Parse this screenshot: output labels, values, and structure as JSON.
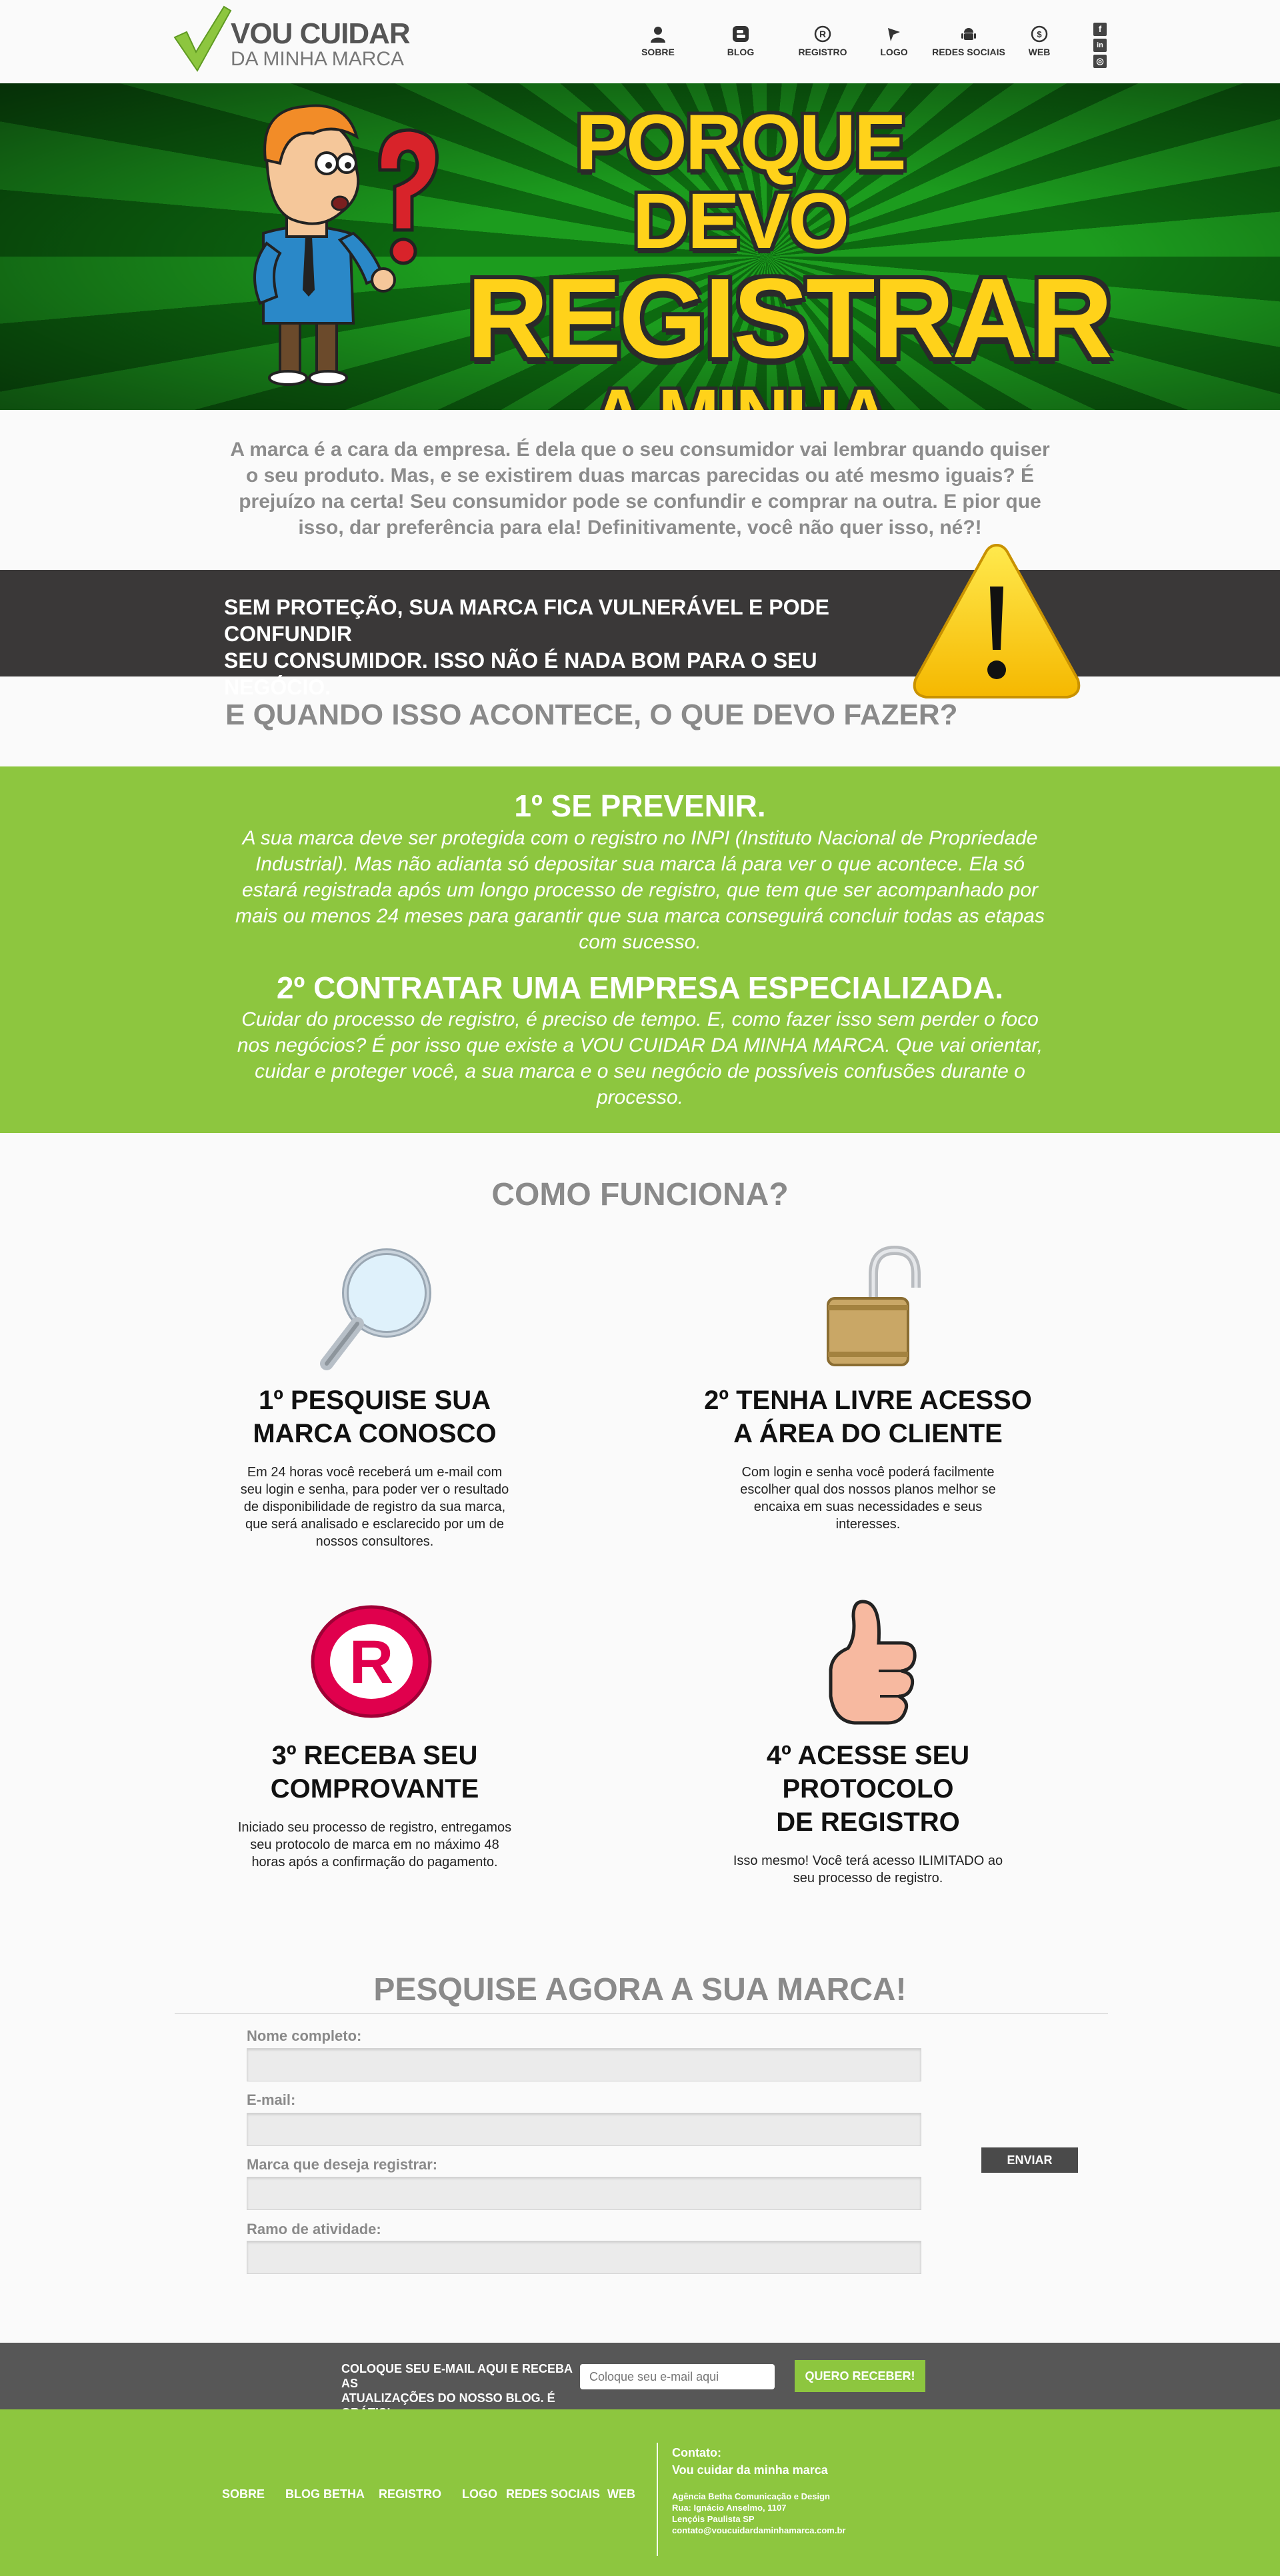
{
  "brand": {
    "line1": "VOU CUIDAR",
    "line2": "DA MINHA MARCA"
  },
  "nav": [
    {
      "label": "SOBRE",
      "icon": "user-icon"
    },
    {
      "label": "BLOG",
      "icon": "blogger-icon"
    },
    {
      "label": "REGISTRO",
      "icon": "registered-icon"
    },
    {
      "label": "LOGO",
      "icon": "pen-nib-icon"
    },
    {
      "label": "REDES SOCIAIS",
      "icon": "android-icon"
    },
    {
      "label": "WEB",
      "icon": "globe-icon"
    }
  ],
  "social": [
    {
      "icon": "facebook-icon",
      "glyph": "f"
    },
    {
      "icon": "linkedin-icon",
      "glyph": "in"
    },
    {
      "icon": "instagram-icon",
      "glyph": "◎"
    }
  ],
  "hero": {
    "line1": "PORQUE DEVO",
    "line2": "REGISTRAR",
    "line3": "A MINHA MARCA?"
  },
  "intro": "A marca é a cara da empresa. É dela que o seu consumidor vai lembrar quando quiser o seu produto. Mas, e se existirem duas marcas parecidas ou até mesmo iguais? É prejuízo na certa! Seu consumidor pode se confundir e comprar na outra. E pior que isso, dar preferência para ela! Definitivamente, você não quer isso, né?!",
  "warning": {
    "line1": "SEM PROTEÇÃO, SUA MARCA FICA VULNERÁVEL E PODE CONFUNDIR",
    "line2": "SEU CONSUMIDOR. ISSO NÃO É NADA BOM PARA O SEU NEGÓCIO."
  },
  "question": "E QUANDO ISSO ACONTECE, O QUE DEVO FAZER?",
  "steps": [
    {
      "title": "1º SE PREVENIR.",
      "text": "A sua marca deve ser protegida com o registro no INPI (Instituto Nacional de Propriedade Industrial). Mas não adianta só depositar sua marca lá para ver o que acontece. Ela só estará registrada após um longo processo de registro, que tem que ser acompanhado por mais ou menos 24 meses para garantir que sua marca conseguirá concluir todas as etapas com sucesso."
    },
    {
      "title": "2º CONTRATAR UMA EMPRESA ESPECIALIZADA.",
      "text": "Cuidar do processo de registro, é preciso de tempo. E, como fazer isso sem perder o foco nos negócios? É por isso que existe a VOU CUIDAR DA MINHA MARCA. Que vai orientar, cuidar e proteger você, a sua marca e o seu negócio de possíveis confusões durante o processo."
    }
  ],
  "how": {
    "title": "COMO FUNCIONA?",
    "items": [
      {
        "icon": "magnifier-icon",
        "title1": "1º PESQUISE SUA",
        "title2": "MARCA CONOSCO",
        "text": "Em 24 horas você receberá um e-mail com seu login e senha, para poder ver o resultado de disponibilidade de registro da sua marca, que será analisado e esclarecido por um de nossos consultores."
      },
      {
        "icon": "open-padlock-icon",
        "title1": "2º TENHA LIVRE ACESSO",
        "title2": "A ÁREA DO CLIENTE",
        "text": "Com login e senha você poderá facilmente escolher qual dos nossos planos melhor se encaixa em suas necessidades e seus interesses."
      },
      {
        "icon": "registered-mark-icon",
        "title1": "3º RECEBA SEU",
        "title2": "COMPROVANTE",
        "text": "Iniciado seu processo de registro, entregamos seu protocolo de marca em no máximo 48 horas após a confirmação do pagamento."
      },
      {
        "icon": "thumbs-up-icon",
        "title1": "4º ACESSE SEU PROTOCOLO",
        "title2": "DE REGISTRO",
        "text": "Isso mesmo! Você terá acesso ILIMITADO ao seu processo de registro."
      }
    ]
  },
  "form": {
    "title": "PESQUISE AGORA A SUA MARCA!",
    "fields": [
      {
        "label": "Nome completo:",
        "value": ""
      },
      {
        "label": "E-mail:",
        "value": ""
      },
      {
        "label": "Marca que deseja registrar:",
        "value": ""
      },
      {
        "label": "Ramo de atividade:",
        "value": ""
      }
    ],
    "submit": "ENVIAR"
  },
  "newsletter": {
    "line1": "COLOQUE SEU E-MAIL AQUI E RECEBA AS",
    "line2": "ATUALIZAÇÕES DO NOSSO BLOG. É GRÁTIS!",
    "placeholder": "Coloque seu e-mail aqui",
    "button": "QUERO RECEBER!"
  },
  "footer": {
    "nav": [
      "SOBRE",
      "BLOG BETHA",
      "REGISTRO",
      "LOGO",
      "REDES SOCIAIS",
      "WEB"
    ],
    "contact_title": "Contato:",
    "contact_name": "Vou cuidar da minha marca",
    "lines": [
      "Agência Betha Comunicação e Design",
      "Rua: Ignácio Anselmo, 1107",
      "Lençóis Paulista SP",
      "contato@voucuidardaminhamarca.com.br"
    ]
  },
  "colors": {
    "accent_green": "#8dc63f",
    "hero_green": "#1c9c1e",
    "hero_yellow": "#ffd21a",
    "dark_band": "#3a3838",
    "newsletter_band": "#575757",
    "muted_text": "#8a8a8a"
  }
}
